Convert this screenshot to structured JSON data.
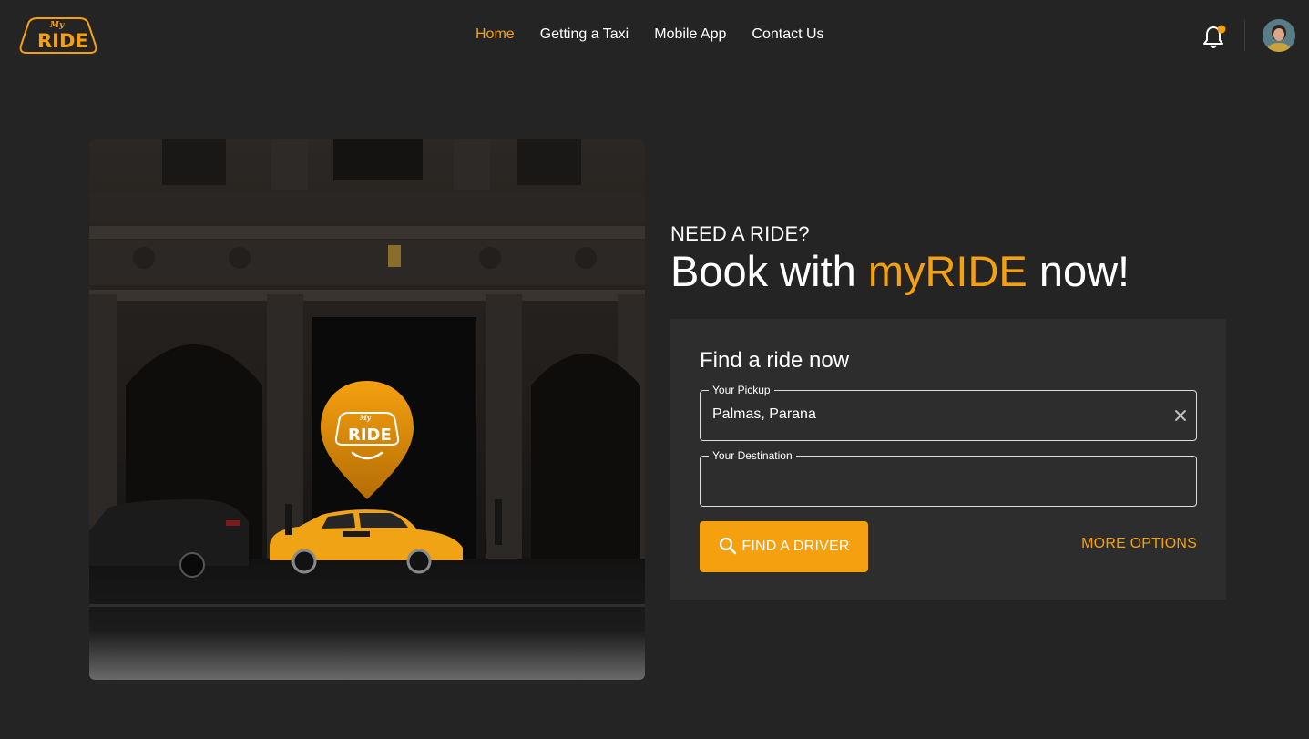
{
  "brand": {
    "logo_small_text": "My",
    "logo_text": "RIDE",
    "accent_color": "#f5a00f"
  },
  "nav": {
    "items": [
      {
        "label": "Home",
        "active": true
      },
      {
        "label": "Getting a Taxi",
        "active": false
      },
      {
        "label": "Mobile App",
        "active": false
      },
      {
        "label": "Contact Us",
        "active": false
      }
    ]
  },
  "header": {
    "notification_icon": "bell-icon",
    "has_unread_notification": true,
    "avatar_icon": "user-avatar"
  },
  "hero": {
    "pin_logo_small_text": "My",
    "pin_logo_text": "RIDE"
  },
  "intro": {
    "eyebrow": "NEED A RIDE?",
    "headline_prefix": "Book with ",
    "headline_brand": "myRIDE",
    "headline_suffix": " now!"
  },
  "form": {
    "title": "Find a ride now",
    "pickup": {
      "label": "Your Pickup",
      "value": "Palmas, Parana"
    },
    "destination": {
      "label": "Your Destination",
      "value": ""
    },
    "find_button": "FIND A DRIVER",
    "more_options": "MORE OPTIONS"
  }
}
